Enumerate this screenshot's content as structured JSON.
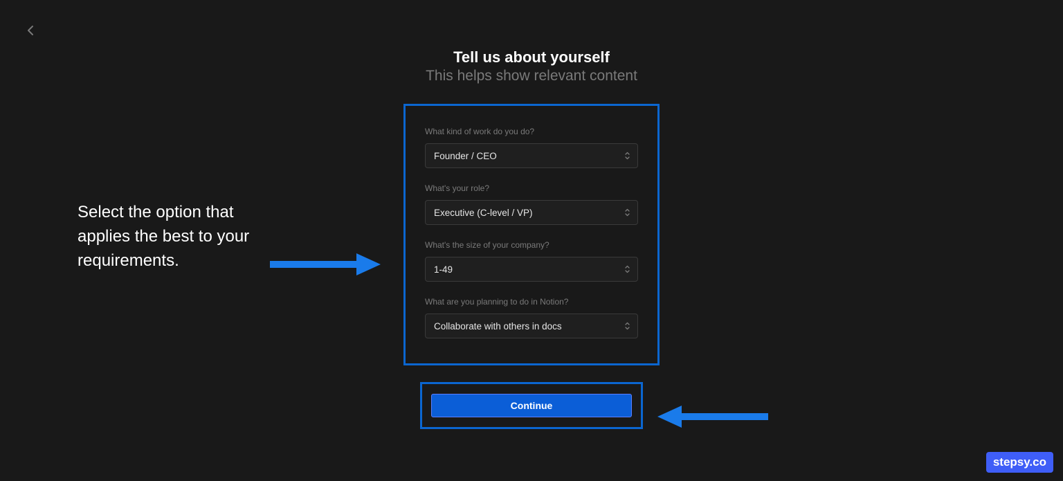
{
  "nav": {
    "back_label": "back"
  },
  "heading": {
    "title": "Tell us about yourself",
    "subtitle": "This helps show relevant content"
  },
  "form": {
    "fields": [
      {
        "label": "What kind of work do you do?",
        "value": "Founder / CEO"
      },
      {
        "label": "What's your role?",
        "value": "Executive (C-level / VP)"
      },
      {
        "label": "What's the size of your company?",
        "value": "1-49"
      },
      {
        "label": "What are you planning to do in Notion?",
        "value": "Collaborate with others in docs"
      }
    ]
  },
  "actions": {
    "continue_label": "Continue"
  },
  "annotations": {
    "instruction": "Select the option that applies the best to your requirements.",
    "colors": {
      "highlight": "#0b66d0",
      "arrow": "#1a7bea",
      "button": "#0b5ed7"
    }
  },
  "watermark": {
    "text": "stepsy.co"
  }
}
